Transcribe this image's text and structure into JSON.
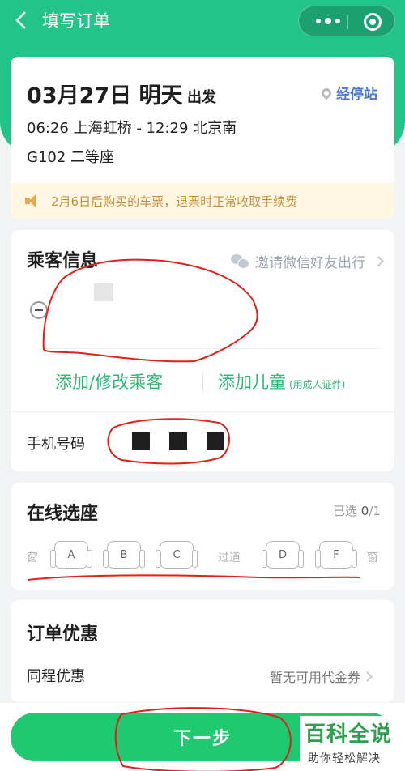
{
  "nav": {
    "title": "填写订单"
  },
  "trip": {
    "date": "03月27日 明天",
    "depart_label": "出发",
    "stops_link": "经停站",
    "route": "06:26 上海虹桥 - 12:29 北京南",
    "train": "G102 二等座",
    "notice": "2月6日后购买的车票，退票时正常收取手续费"
  },
  "passenger": {
    "title": "乘客信息",
    "invite": "邀请微信好友出行",
    "add_edit": "添加/修改乘客",
    "add_child": "添加儿童",
    "add_child_note": "(用成人证件)",
    "phone_label": "手机号码"
  },
  "seat": {
    "title": "在线选座",
    "selected_prefix": "已选",
    "selected_count": "0",
    "selected_total": "/1",
    "window_label": "窗",
    "aisle_label": "过道",
    "seats": [
      "A",
      "B",
      "C",
      "D",
      "F"
    ]
  },
  "promo": {
    "title": "订单优惠",
    "label": "同程优惠",
    "value": "暂无可用代金券"
  },
  "footer": {
    "next_label": "下一步"
  },
  "watermark": {
    "title": "百科全说",
    "subtitle": "助你轻松解决"
  },
  "colors": {
    "brand_green": "#22c48a",
    "button_green": "#1fc970",
    "link_blue": "#4a7ad6",
    "notice_text": "#c58f3e",
    "annotation_red": "#e0201b"
  }
}
